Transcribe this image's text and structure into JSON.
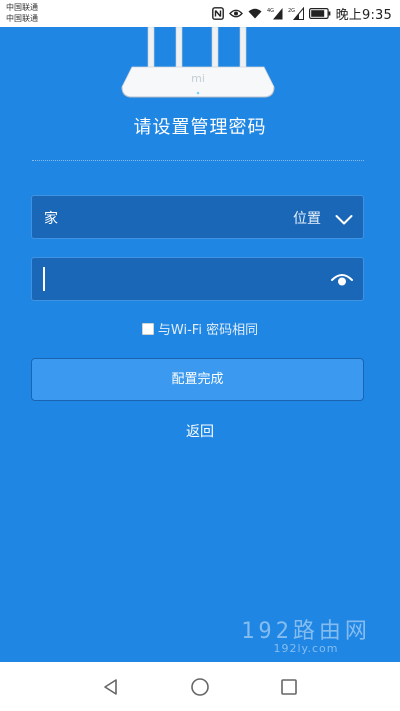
{
  "status_bar": {
    "carrier_1": "中国联通",
    "carrier_2": "中国联通",
    "network_1": "4G",
    "network_2": "2G",
    "time": "晚上9:35",
    "icons": [
      "nfc-icon",
      "eye-comfort-icon",
      "wifi-icon",
      "signal-icon",
      "signal-icon",
      "battery-icon"
    ]
  },
  "page": {
    "brand_logo": "mi",
    "title": "请设置管理密码",
    "location": {
      "value": "家",
      "label": "位置"
    },
    "password": {
      "value": ""
    },
    "same_as_wifi_label": "与Wi-Fi 密码相同",
    "same_as_wifi_checked": false,
    "submit_label": "配置完成",
    "back_label": "返回"
  },
  "watermark": {
    "main": "192路由网",
    "sub": "192ly.com"
  },
  "nav_bar": {
    "buttons": [
      "back-triangle-icon",
      "home-circle-icon",
      "recent-square-icon"
    ]
  },
  "colors": {
    "background": "#1f86e3",
    "field": "#1a67b8",
    "button": "#3b9af0"
  }
}
